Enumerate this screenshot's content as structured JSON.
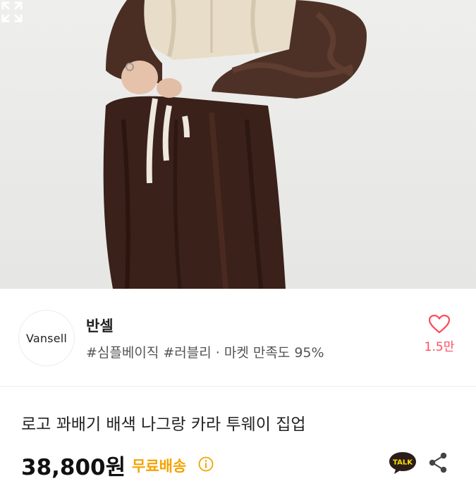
{
  "seller": {
    "logo_text": "Vansell",
    "name": "반셀",
    "tags": "#심플베이직 #러블리 · 마켓 만족도 95%",
    "favorite_count": "1.5만"
  },
  "product": {
    "title": "로고 꽈배기 배색 나그랑 카라 투웨이 집업",
    "price": "38,800원",
    "shipping_badge": "무료배송",
    "talk_label": "TALK"
  },
  "icons": {
    "expand": "expand-icon",
    "heart": "heart-icon",
    "info": "info-icon",
    "talk": "kakao-talk-icon",
    "share": "share-icon"
  },
  "colors": {
    "heart": "#ff4b5c",
    "shipping": "#f5a300",
    "talk_bubble": "#2b1d1a",
    "talk_bubble_fill": "#fae100"
  }
}
